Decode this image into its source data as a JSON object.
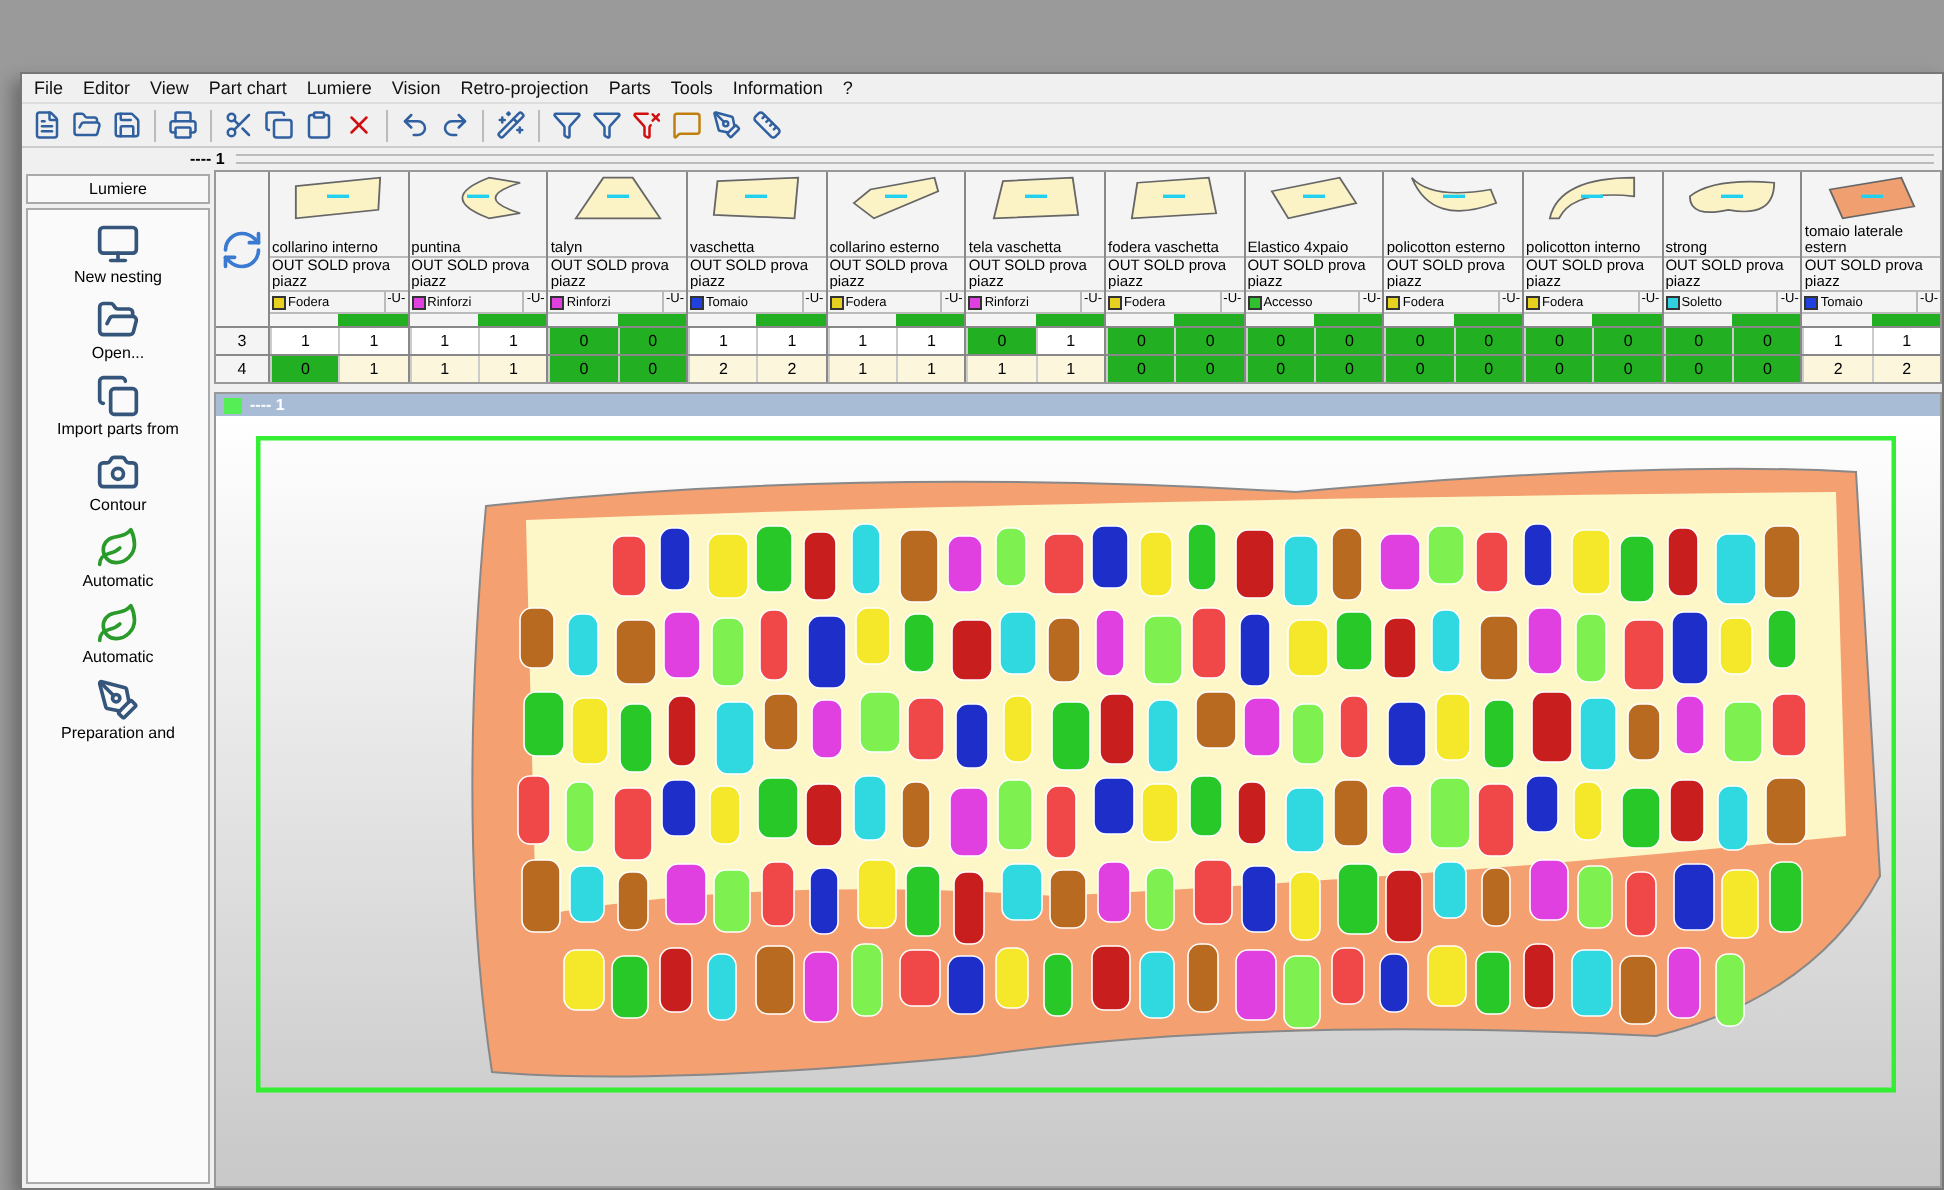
{
  "menu": [
    "File",
    "Editor",
    "View",
    "Part chart",
    "Lumiere",
    "Vision",
    "Retro-projection",
    "Parts",
    "Tools",
    "Information",
    "?"
  ],
  "tab_label": "---- 1",
  "sidebar": {
    "title": "Lumiere",
    "items": [
      {
        "label": "New nesting",
        "kind": "new"
      },
      {
        "label": "Open...",
        "kind": "open"
      },
      {
        "label": "Import parts from",
        "kind": "import"
      },
      {
        "label": "Contour",
        "kind": "camera"
      },
      {
        "label": "Automatic",
        "kind": "hide"
      },
      {
        "label": "Automatic",
        "kind": "hidecursor"
      },
      {
        "label": "Preparation and",
        "kind": "pen"
      }
    ]
  },
  "parts": {
    "row_labels": [
      "3",
      "4"
    ],
    "columns": [
      {
        "name": "collarino interno",
        "order": "OUT SOLD prova piazz",
        "material": "Fodera",
        "color": "#e8d020",
        "unit": "-U-",
        "rows": [
          [
            {
              "value": "1",
              "done": false
            },
            {
              "value": "1",
              "done": false
            }
          ],
          [
            {
              "value": "0",
              "done": true
            },
            {
              "value": "1",
              "done": false
            }
          ]
        ]
      },
      {
        "name": "puntina",
        "order": "OUT SOLD prova piazz",
        "material": "Rinforzi",
        "color": "#e040e0",
        "unit": "-U-",
        "rows": [
          [
            {
              "value": "1",
              "done": false
            },
            {
              "value": "1",
              "done": false
            }
          ],
          [
            {
              "value": "1",
              "done": false
            },
            {
              "value": "1",
              "done": false
            }
          ]
        ]
      },
      {
        "name": "talyn",
        "order": "OUT SOLD prova piazz",
        "material": "Rinforzi",
        "color": "#e040e0",
        "unit": "-U-",
        "rows": [
          [
            {
              "value": "0",
              "done": true
            },
            {
              "value": "0",
              "done": true
            }
          ],
          [
            {
              "value": "0",
              "done": true
            },
            {
              "value": "0",
              "done": true
            }
          ]
        ]
      },
      {
        "name": "vaschetta",
        "order": "OUT SOLD prova piazz",
        "material": "Tomaio",
        "color": "#2040e0",
        "unit": "-U-",
        "rows": [
          [
            {
              "value": "1",
              "done": false
            },
            {
              "value": "1",
              "done": false
            }
          ],
          [
            {
              "value": "2",
              "done": false
            },
            {
              "value": "2",
              "done": false
            }
          ]
        ]
      },
      {
        "name": "collarino esterno",
        "order": "OUT SOLD prova piazz",
        "material": "Fodera",
        "color": "#e8d020",
        "unit": "-U-",
        "rows": [
          [
            {
              "value": "1",
              "done": false
            },
            {
              "value": "1",
              "done": false
            }
          ],
          [
            {
              "value": "1",
              "done": false
            },
            {
              "value": "1",
              "done": false
            }
          ]
        ]
      },
      {
        "name": "tela vaschetta",
        "order": "OUT SOLD prova piazz",
        "material": "Rinforzi",
        "color": "#e040e0",
        "unit": "-U-",
        "rows": [
          [
            {
              "value": "0",
              "done": true
            },
            {
              "value": "1",
              "done": false
            }
          ],
          [
            {
              "value": "1",
              "done": false
            },
            {
              "value": "1",
              "done": false
            }
          ]
        ]
      },
      {
        "name": "fodera vaschetta",
        "order": "OUT SOLD prova piazz",
        "material": "Fodera",
        "color": "#e8d020",
        "unit": "-U-",
        "rows": [
          [
            {
              "value": "0",
              "done": true
            },
            {
              "value": "0",
              "done": true
            }
          ],
          [
            {
              "value": "0",
              "done": true
            },
            {
              "value": "0",
              "done": true
            }
          ]
        ]
      },
      {
        "name": "Elastico 4xpaio",
        "order": "OUT SOLD prova piazz",
        "material": "Accesso",
        "color": "#30c030",
        "unit": "-U-",
        "rows": [
          [
            {
              "value": "0",
              "done": true
            },
            {
              "value": "0",
              "done": true
            }
          ],
          [
            {
              "value": "0",
              "done": true
            },
            {
              "value": "0",
              "done": true
            }
          ]
        ]
      },
      {
        "name": "policotton esterno",
        "order": "OUT SOLD prova piazz",
        "material": "Fodera",
        "color": "#e8d020",
        "unit": "-U-",
        "rows": [
          [
            {
              "value": "0",
              "done": true
            },
            {
              "value": "0",
              "done": true
            }
          ],
          [
            {
              "value": "0",
              "done": true
            },
            {
              "value": "0",
              "done": true
            }
          ]
        ]
      },
      {
        "name": "policotton interno",
        "order": "OUT SOLD prova piazz",
        "material": "Fodera",
        "color": "#e8d020",
        "unit": "-U-",
        "rows": [
          [
            {
              "value": "0",
              "done": true
            },
            {
              "value": "0",
              "done": true
            }
          ],
          [
            {
              "value": "0",
              "done": true
            },
            {
              "value": "0",
              "done": true
            }
          ]
        ]
      },
      {
        "name": "strong",
        "order": "OUT SOLD prova piazz",
        "material": "Soletto",
        "color": "#30d0e0",
        "unit": "-U-",
        "rows": [
          [
            {
              "value": "0",
              "done": true
            },
            {
              "value": "0",
              "done": true
            }
          ],
          [
            {
              "value": "0",
              "done": true
            },
            {
              "value": "0",
              "done": true
            }
          ]
        ]
      },
      {
        "name": "tomaio laterale estern",
        "order": "OUT SOLD prova piazz",
        "material": "Tomaio",
        "color": "#2040e0",
        "unit": "-U-",
        "rows": [
          [
            {
              "value": "1",
              "done": false
            },
            {
              "value": "1",
              "done": false
            }
          ],
          [
            {
              "value": "2",
              "done": false
            },
            {
              "value": "2",
              "done": false
            }
          ]
        ]
      }
    ]
  },
  "canvas": {
    "title": "---- 1"
  }
}
